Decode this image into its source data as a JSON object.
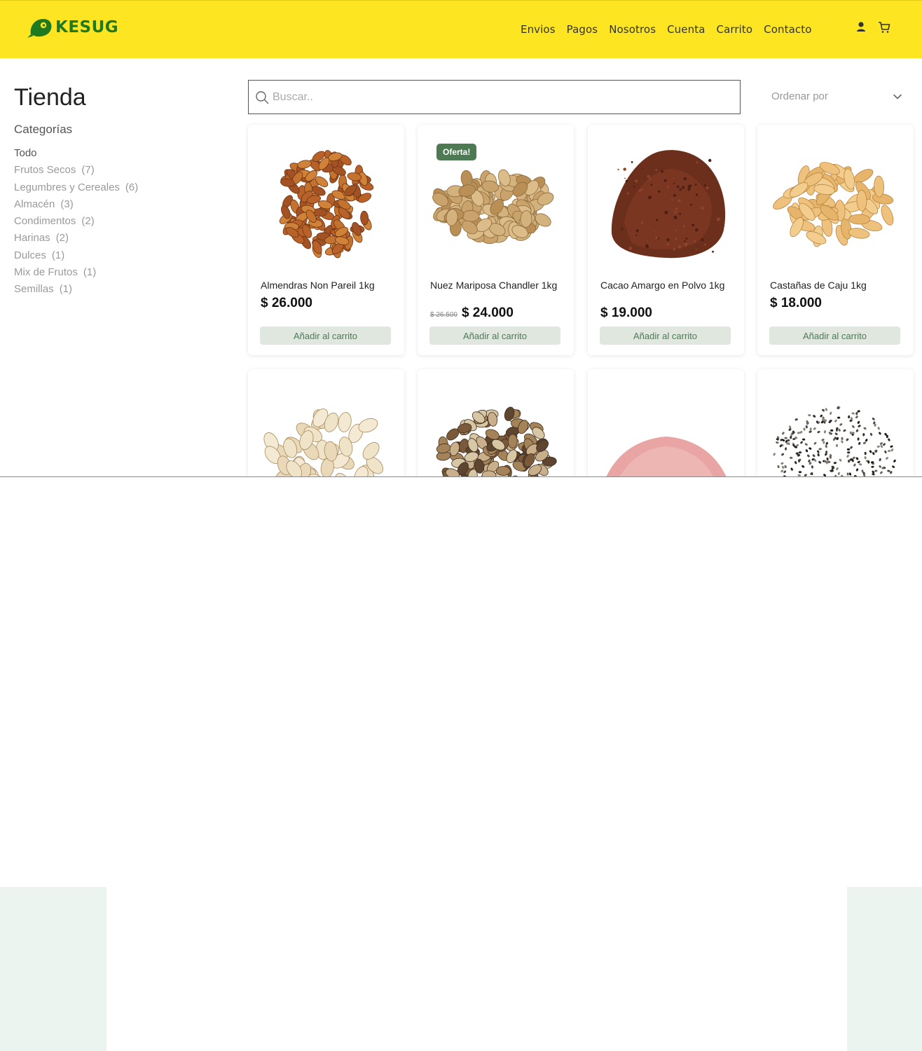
{
  "brand": {
    "name": "KESUG",
    "color": "#1f7a1f",
    "header_bg": "#fde621"
  },
  "nav": [
    "Envios",
    "Pagos",
    "Nosotros",
    "Cuenta",
    "Carrito",
    "Contacto"
  ],
  "header_icons": [
    "user-icon",
    "cart-icon"
  ],
  "shop": {
    "title": "Tienda",
    "categories_heading": "Categorías"
  },
  "categories": [
    {
      "name": "Todo",
      "count": "",
      "active": true
    },
    {
      "name": "Frutos Secos",
      "count": "(7)"
    },
    {
      "name": "Legumbres y Cereales",
      "count": "(6)"
    },
    {
      "name": "Almacén",
      "count": "(3)"
    },
    {
      "name": "Condimentos",
      "count": "(2)"
    },
    {
      "name": "Harinas",
      "count": "(2)"
    },
    {
      "name": "Dulces",
      "count": "(1)"
    },
    {
      "name": "Mix de Frutos",
      "count": "(1)"
    },
    {
      "name": "Semillas",
      "count": "(1)"
    }
  ],
  "search": {
    "placeholder": "Buscar..",
    "value": ""
  },
  "sort": {
    "label": "Ordenar por"
  },
  "products": [
    {
      "name": "Almendras Non Pareil 1kg",
      "price": "$ 26.000",
      "old_price": "",
      "badge": "",
      "button": "Añadir al carrito",
      "image": "almonds"
    },
    {
      "name": "Nuez Mariposa Chandler 1kg",
      "price": "$ 24.000",
      "old_price": "$ 26.500",
      "badge": "Oferta!",
      "button": "Añadir al carrito",
      "image": "walnuts"
    },
    {
      "name": "Cacao Amargo en Polvo 1kg",
      "price": "$ 19.000",
      "old_price": "",
      "badge": "",
      "button": "Añadir al carrito",
      "image": "cocoa-powder"
    },
    {
      "name": "Castañas de Caju 1kg",
      "price": "$ 18.000",
      "old_price": "",
      "badge": "",
      "button": "Añadir al carrito",
      "image": "cashews"
    },
    {
      "image": "pistachios"
    },
    {
      "image": "mixed-nuts"
    },
    {
      "image": "pink-salt"
    },
    {
      "image": "chia-seeds"
    }
  ],
  "colors": {
    "accent_green": "#4d7a53",
    "button_bg": "#dfe7df",
    "footer_band": "#ecf4f0"
  }
}
